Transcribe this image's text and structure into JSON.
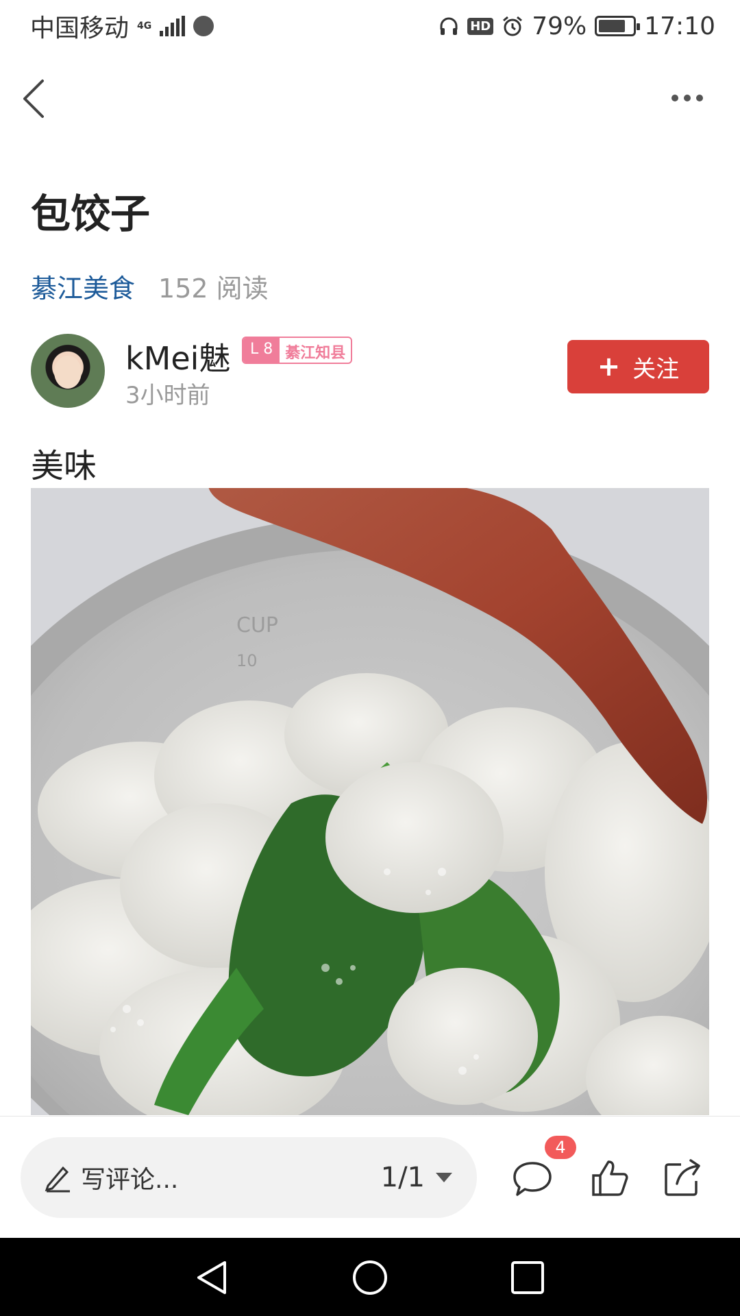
{
  "status_bar": {
    "carrier": "中国移动",
    "network": "4G",
    "hd_label": "HD",
    "battery_percent": "79%",
    "battery_level": 0.79,
    "time": "17:10"
  },
  "nav": {
    "back_icon": "back-chevron-icon",
    "more_icon": "more-dots-icon"
  },
  "article": {
    "title": "包饺子",
    "channel": "綦江美食",
    "reads": "152 阅读",
    "author": {
      "name": "kMei魅",
      "level": "L 8",
      "title_badge": "綦江知县",
      "time": "3小时前"
    },
    "follow_label": "关注",
    "body_text": "美味",
    "image_desc_icon": "dumplings-photo"
  },
  "bottom_bar": {
    "comment_placeholder": "写评论...",
    "pager": "1/1",
    "comment_count": "4"
  },
  "colors": {
    "accent_red": "#d9403a",
    "link_blue": "#1c5a99",
    "badge_pink": "#f07d9a"
  }
}
